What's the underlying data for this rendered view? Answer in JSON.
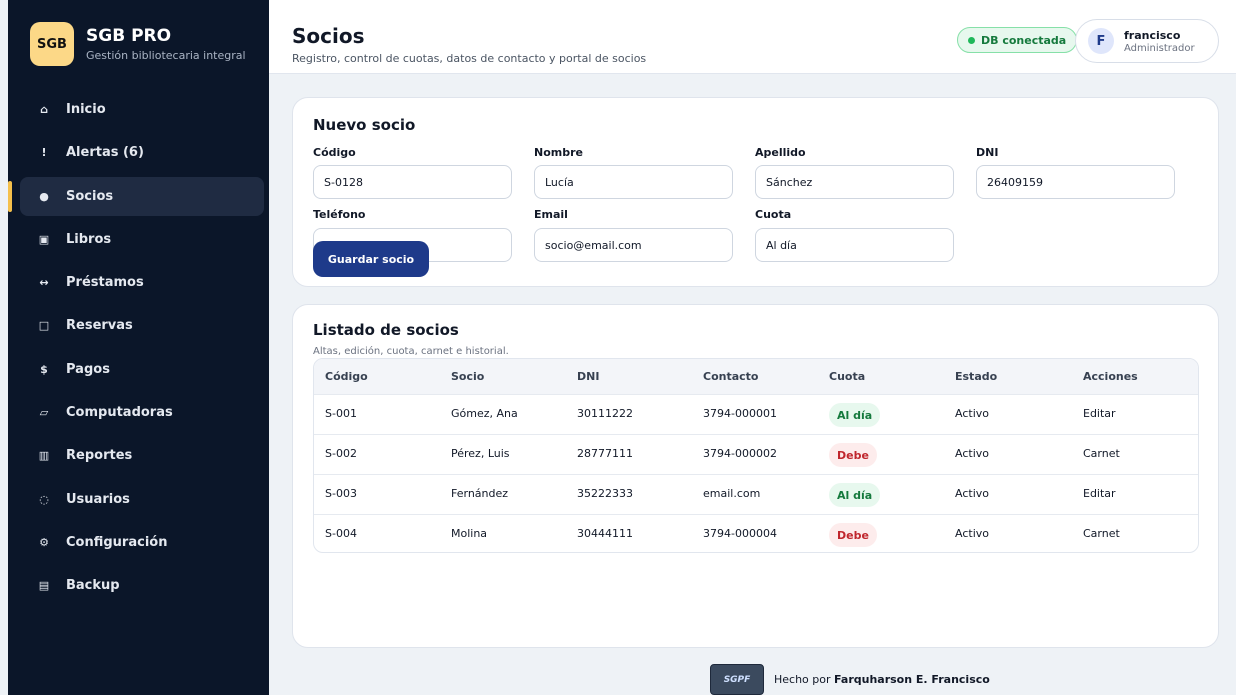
{
  "sidebar": {
    "brand": {
      "logo": "SGB",
      "title": "SGB PRO",
      "subtitle": "Gestión bibliotecaria integral"
    },
    "items": [
      {
        "label": "Inicio",
        "icon": "⌂",
        "icon_name": "home-icon"
      },
      {
        "label": "Alertas (6)",
        "icon": "!",
        "icon_name": "alert-icon"
      },
      {
        "label": "Socios",
        "icon": "●",
        "icon_name": "member-icon",
        "active": true
      },
      {
        "label": "Libros",
        "icon": "▣",
        "icon_name": "book-icon"
      },
      {
        "label": "Préstamos",
        "icon": "↔",
        "icon_name": "swap-icon"
      },
      {
        "label": "Reservas",
        "icon": "□",
        "icon_name": "reservation-icon"
      },
      {
        "label": "Pagos",
        "icon": "$",
        "icon_name": "payment-icon"
      },
      {
        "label": "Computadoras",
        "icon": "▱",
        "icon_name": "computer-icon"
      },
      {
        "label": "Reportes",
        "icon": "▥",
        "icon_name": "report-icon"
      },
      {
        "label": "Usuarios",
        "icon": "◌",
        "icon_name": "users-icon"
      },
      {
        "label": "Configuración",
        "icon": "⚙",
        "icon_name": "gear-icon"
      },
      {
        "label": "Backup",
        "icon": "▤",
        "icon_name": "backup-icon"
      }
    ]
  },
  "header": {
    "title": "Socios",
    "subtitle": "Registro, control de cuotas, datos de contacto y portal de socios",
    "db_status": "DB conectada",
    "user": {
      "initial": "F",
      "name": "francisco",
      "role": "Administrador"
    }
  },
  "form": {
    "title": "Nuevo socio",
    "labels": {
      "codigo": "Código",
      "nombre": "Nombre",
      "apellido": "Apellido",
      "dni": "DNI",
      "telefono": "Teléfono",
      "email": "Email",
      "cuota": "Cuota"
    },
    "values": {
      "codigo": "S-0128",
      "nombre": "Lucía",
      "apellido": "Sánchez",
      "dni": "26409159",
      "telefono": "",
      "email": "socio@email.com",
      "cuota": "Al día"
    },
    "save_label": "Guardar socio"
  },
  "list": {
    "title": "Listado de socios",
    "subtitle": "Altas, edición, cuota, carnet e historial.",
    "columns": [
      "Código",
      "Socio",
      "DNI",
      "Contacto",
      "Cuota",
      "Estado",
      "Acciones"
    ],
    "rows": [
      {
        "codigo": "S-001",
        "socio": "Gómez, Ana",
        "dni": "30111222",
        "contacto": "3794-000001",
        "cuota": "Al día",
        "cuota_ok": true,
        "estado": "Activo",
        "accion": "Editar"
      },
      {
        "codigo": "S-002",
        "socio": "Pérez, Luis",
        "dni": "28777111",
        "contacto": "3794-000002",
        "cuota": "Debe",
        "cuota_ok": false,
        "estado": "Activo",
        "accion": "Carnet"
      },
      {
        "codigo": "S-003",
        "socio": "Fernández",
        "dni": "35222333",
        "contacto": "email.com",
        "cuota": "Al día",
        "cuota_ok": true,
        "estado": "Activo",
        "accion": "Editar"
      },
      {
        "codigo": "S-004",
        "socio": "Molina",
        "dni": "30444111",
        "contacto": "3794-000004",
        "cuota": "Debe",
        "cuota_ok": false,
        "estado": "Activo",
        "accion": "Carnet"
      }
    ]
  },
  "footer": {
    "logo_text": "SGPF",
    "prefix": "Hecho por",
    "author": "Farquharson E. Francisco"
  },
  "colors": {
    "sidebar_bg": "#0b1629",
    "accent": "#f5c04b",
    "primary": "#1e3a8a",
    "ok": "#157a3d",
    "debt": "#c0262d"
  }
}
